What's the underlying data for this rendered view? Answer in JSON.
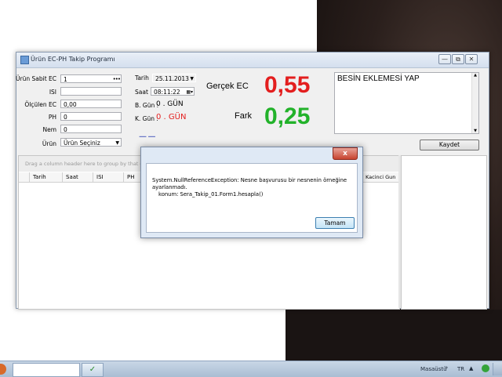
{
  "window": {
    "title": "Ürün EC-PH Takip Programı",
    "controls": [
      "—",
      "⧉",
      "✕"
    ]
  },
  "form": {
    "labels": {
      "urun_sabit_ec": "Ürün Sabit EC",
      "isi": "ISI",
      "olculen_ec": "Ölçülen EC",
      "ph": "PH",
      "nem": "Nem",
      "urun": "Ürün",
      "tarih": "Tarih",
      "saat": "Saat",
      "b_gun": "B. Gün :",
      "k_gun": "K. Gün :",
      "gercek_ec": "Gerçek EC",
      "fark": "Fark"
    },
    "values": {
      "urun_sabit_ec": "1",
      "isi": "",
      "olculen_ec": "0,00",
      "ph": "0",
      "nem": "0",
      "urun": "Ürün Seçiniz",
      "tarih": "25.11.2013",
      "saat": "08:11:22",
      "b_gun": "0 . GÜN",
      "k_gun": "0 . GÜN",
      "gercek_ec": "0,55",
      "fark": "0,25"
    },
    "lookup_button": "•••",
    "dash_marker": "— —",
    "note": "BESİN EKLEMESİ YAP",
    "save_button": "Kaydet"
  },
  "grid": {
    "group_hint": "Drag a column header here to group by that column",
    "columns": [
      "Tarih",
      "Saat",
      "ISI",
      "PH"
    ],
    "right_column": "Kacinci Gun"
  },
  "dialog": {
    "close": "x",
    "message_line1": "System.NullReferenceException: Nesne başvurusu bir nesnenin örneğine",
    "message_line2": "ayarlanmadı.",
    "message_line3": "   konum: Sera_Takip_01.Form1.hesapla()",
    "ok_button": "Tamam"
  },
  "taskbar": {
    "desktop": "Masaüstü",
    "language": "TR"
  },
  "colors": {
    "ec_red": "#e31e1e",
    "fark_green": "#22b22a",
    "k_gun_red": "#e31e1e"
  }
}
